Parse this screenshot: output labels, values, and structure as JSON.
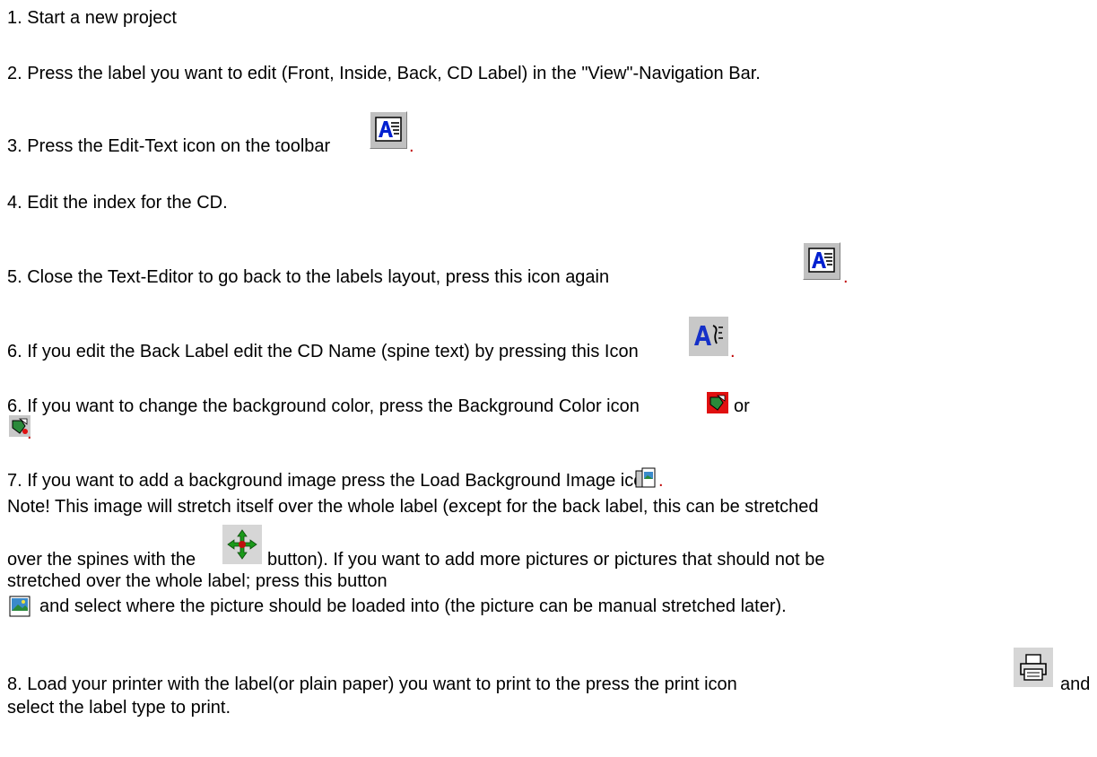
{
  "steps": {
    "s1": "1. Start a new project",
    "s2": "2. Press the label you want to edit (Front, Inside, Back, CD Label) in the \"View\"-Navigation Bar.",
    "s3": "3. Press the Edit-Text icon on the toolbar",
    "s4": "4. Edit the index for the CD.",
    "s5": "5. Close the Text-Editor to go back to the labels layout, press this icon again",
    "s6a": "6. If you edit the Back Label edit the CD Name (spine text) by pressing this Icon",
    "s6b": "6. If you want to change the background color, press the Background Color icon",
    "s6b_or": "or",
    "s7": "7. If you want to add a background image press the Load Background Image icon",
    "note1": "Note! This image will stretch itself over the whole label (except for the back label, this can be stretched",
    "note2a": "over the spines with the",
    "note2b": "button). If you want to add more pictures or pictures that should not be",
    "note3": "stretched over the whole label; press this button",
    "note4": "and select where the picture should be loaded into (the picture can be manual stretched later).",
    "s8a": "8. Load your printer with the label(or plain paper) you want to print to the press the print icon",
    "s8b": "and",
    "s8c": "select the label type to print.",
    "period": "."
  },
  "icons": {
    "edit_text": "edit-text-icon",
    "spine_text": "spine-text-icon",
    "bg_color": "background-color-icon",
    "bg_color_alt": "background-color-alt-icon",
    "load_bg_image": "load-background-image-icon",
    "stretch_spines": "stretch-spines-icon",
    "add_picture": "add-picture-icon",
    "print": "print-icon"
  },
  "colors": {
    "period_accent": "#c00000",
    "icon_face": "#c0c0c0"
  }
}
